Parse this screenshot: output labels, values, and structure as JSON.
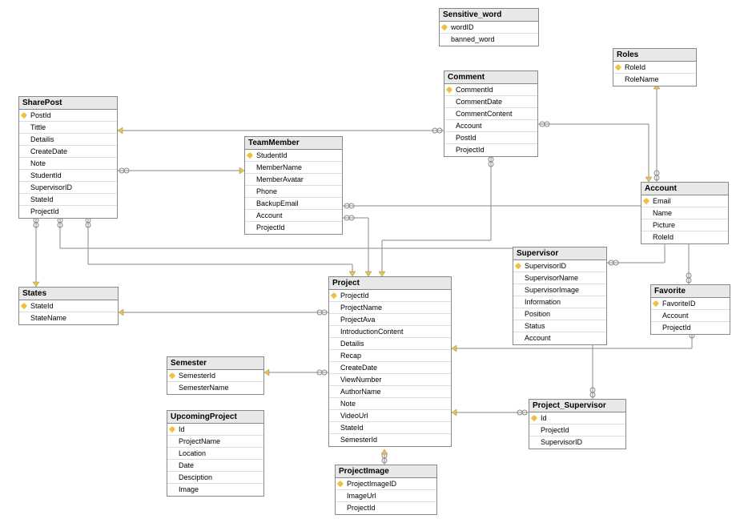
{
  "tables": {
    "sensitive_word": {
      "title": "Sensitive_word",
      "cols": [
        "wordID",
        "banned_word"
      ],
      "pk": [
        0
      ]
    },
    "roles": {
      "title": "Roles",
      "cols": [
        "RoleId",
        "RoleName"
      ],
      "pk": [
        0
      ]
    },
    "comment": {
      "title": "Comment",
      "cols": [
        "CommentId",
        "CommentDate",
        "CommentContent",
        "Account",
        "PostId",
        "ProjectId"
      ],
      "pk": [
        0
      ]
    },
    "sharepost": {
      "title": "SharePost",
      "cols": [
        "PostId",
        "Tittle",
        "Detailis",
        "CreateDate",
        "Note",
        "StudentId",
        "SupervisorID",
        "StateId",
        "ProjectId"
      ],
      "pk": [
        0
      ]
    },
    "teammember": {
      "title": "TeamMember",
      "cols": [
        "StudentId",
        "MemberName",
        "MemberAvatar",
        "Phone",
        "BackupEmail",
        "Account",
        "ProjectId"
      ],
      "pk": [
        0
      ]
    },
    "account": {
      "title": "Account",
      "cols": [
        "Email",
        "Name",
        "Picture",
        "RoleId"
      ],
      "pk": [
        0
      ]
    },
    "supervisor": {
      "title": "Supervisor",
      "cols": [
        "SupervisorID",
        "SupervisorName",
        "SupervisorImage",
        "Information",
        "Position",
        "Status",
        "Account"
      ],
      "pk": [
        0
      ]
    },
    "states": {
      "title": "States",
      "cols": [
        "StateId",
        "StateName"
      ],
      "pk": [
        0
      ]
    },
    "project": {
      "title": "Project",
      "cols": [
        "ProjectId",
        "ProjectName",
        "ProjectAva",
        "IntroductionContent",
        "Detailis",
        "Recap",
        "CreateDate",
        "ViewNumber",
        "AuthorName",
        "Note",
        "VideoUrl",
        "StateId",
        "SemesterId"
      ],
      "pk": [
        0
      ]
    },
    "favorite": {
      "title": "Favorite",
      "cols": [
        "FavoriteID",
        "Account",
        "ProjectId"
      ],
      "pk": [
        0
      ]
    },
    "semester": {
      "title": "Semester",
      "cols": [
        "SemesterId",
        "SemesterName"
      ],
      "pk": [
        0
      ]
    },
    "upcomingproject": {
      "title": "UpcomingProject",
      "cols": [
        "Id",
        "ProjectName",
        "Location",
        "Date",
        "Desciption",
        "Image"
      ],
      "pk": [
        0
      ]
    },
    "project_supervisor": {
      "title": "Project_Supervisor",
      "cols": [
        "Id",
        "ProjectId",
        "SupervisorID"
      ],
      "pk": [
        0
      ]
    },
    "projectimage": {
      "title": "ProjectImage",
      "cols": [
        "ProjectImageID",
        "ImageUrl",
        "ProjectId"
      ],
      "pk": [
        0
      ]
    }
  }
}
